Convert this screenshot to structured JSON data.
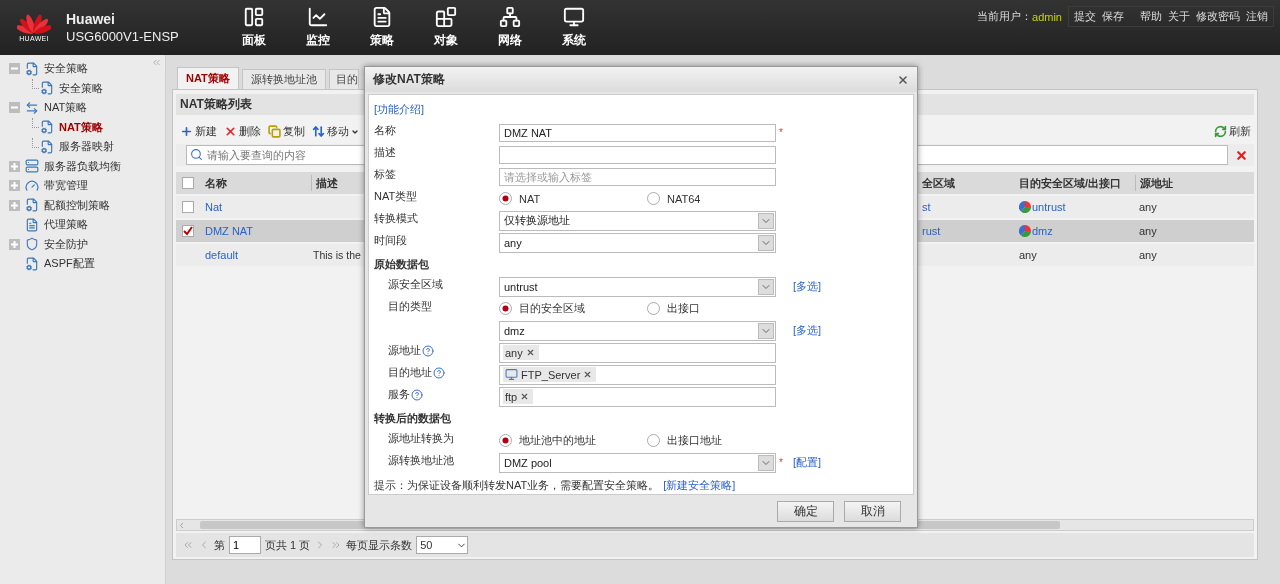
{
  "header": {
    "logo_text": "HUAWEI",
    "brand": "Huawei",
    "model": "USG6000V1-ENSP",
    "nav": [
      "面板",
      "监控",
      "策略",
      "对象",
      "网络",
      "系统"
    ],
    "user_label": "当前用户：",
    "user": "admin",
    "actions": [
      "提交",
      "保存"
    ],
    "links": [
      "帮助",
      "关于",
      "修改密码",
      "注销"
    ]
  },
  "sidebar": {
    "items": [
      {
        "label": "安全策略",
        "expanded": true,
        "children": [
          {
            "label": "安全策略",
            "selected": false
          }
        ]
      },
      {
        "label": "NAT策略",
        "expanded": true,
        "children": [
          {
            "label": "NAT策略",
            "selected": true
          },
          {
            "label": "服务器映射",
            "selected": false
          }
        ]
      },
      {
        "label": "服务器负载均衡",
        "expanded": false
      },
      {
        "label": "带宽管理",
        "expanded": false
      },
      {
        "label": "配额控制策略",
        "expanded": false
      },
      {
        "label": "代理策略"
      },
      {
        "label": "安全防护",
        "expanded": false
      },
      {
        "label": "ASPF配置"
      }
    ]
  },
  "tabs": [
    {
      "label": "NAT策略",
      "selected": true
    },
    {
      "label": "源转换地址池",
      "selected": false
    },
    {
      "label": "目的",
      "selected": false
    }
  ],
  "panel": {
    "title": "NAT策略列表",
    "toolbar": [
      {
        "label": "新建",
        "kind": "add"
      },
      {
        "label": "删除",
        "kind": "delete"
      },
      {
        "label": "复制",
        "kind": "copy"
      },
      {
        "label": "移动",
        "kind": "move"
      }
    ],
    "refresh": "刷新",
    "search": {
      "placeholder": "请输入要查询的内容"
    },
    "table": {
      "select_all": {
        "checked": false
      },
      "columns": [
        "名称",
        "描述",
        "全区域",
        "目的安全区域/出接口",
        "源地址"
      ],
      "rows": [
        {
          "checked": false,
          "name": "Nat",
          "column_3": "st",
          "destination": "untrust",
          "zone_icon": true,
          "source": "any"
        },
        {
          "checked": true,
          "name": "DMZ NAT",
          "column_3": "rust",
          "destination": "dmz",
          "zone_icon": true,
          "source": "any"
        },
        {
          "name": "default",
          "description": "This is the",
          "destination": "any",
          "zone_icon": false,
          "source": "any"
        }
      ]
    },
    "pager": {
      "page_label": "第",
      "page": "1",
      "page_total": "页共 1 页",
      "page_size_label": "每页显示条数",
      "page_size": "50"
    }
  },
  "dialog": {
    "title": "修改NAT策略",
    "help_link": "[功能介绍]",
    "groups": [
      {
        "fields": [
          {
            "kind": "text",
            "label": "名称",
            "value": "DMZ NAT",
            "required_mark": "*"
          },
          {
            "kind": "text",
            "label": "描述"
          },
          {
            "kind": "text",
            "label": "标签",
            "placeholder": "请选择或输入标签"
          },
          {
            "kind": "radio",
            "label": "NAT类型",
            "options": [
              {
                "label": "NAT",
                "selected": true
              },
              {
                "label": "NAT64",
                "selected": false
              }
            ]
          },
          {
            "kind": "select",
            "label": "转换模式",
            "value": "仅转换源地址"
          },
          {
            "kind": "select",
            "label": "时间段",
            "value": "any"
          }
        ]
      },
      {
        "heading": "原始数据包",
        "fields": [
          {
            "kind": "select",
            "label": "源安全区域",
            "value": "untrust",
            "link": "[多选]"
          },
          {
            "kind": "radio",
            "label": "目的类型",
            "options": [
              {
                "label": "目的安全区域",
                "selected": true
              },
              {
                "label": "出接口",
                "selected": false
              }
            ]
          },
          {
            "kind": "select",
            "value": "dmz",
            "link": "[多选]"
          },
          {
            "kind": "tags",
            "label": "源地址",
            "help": true,
            "tags": [
              {
                "label": "any",
                "kind": "plain"
              }
            ]
          },
          {
            "kind": "tags",
            "label": "目的地址",
            "help": true,
            "tags": [
              {
                "label": "FTP_Server",
                "kind": "host"
              }
            ]
          },
          {
            "kind": "tags",
            "label": "服务",
            "help": true,
            "tags": [
              {
                "label": "ftp",
                "kind": "plain"
              }
            ]
          }
        ]
      },
      {
        "heading": "转换后的数据包",
        "fields": [
          {
            "kind": "radio",
            "label": "源地址转换为",
            "options": [
              {
                "label": "地址池中的地址",
                "selected": true
              },
              {
                "label": "出接口地址",
                "selected": false
              }
            ]
          },
          {
            "kind": "select",
            "label": "源转换地址池",
            "value": "DMZ pool",
            "required_mark": "*",
            "link": "[配置]"
          }
        ]
      }
    ],
    "hint": {
      "text": "提示：为保证设备顺利转发NAT业务，需要配置安全策略。",
      "link": "[新建安全策略]"
    },
    "buttons": [
      "确定",
      "取消"
    ]
  }
}
